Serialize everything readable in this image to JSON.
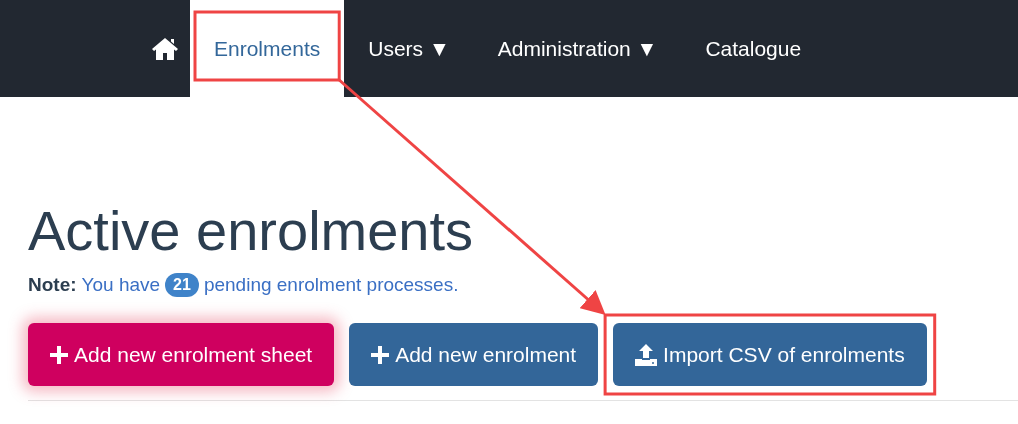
{
  "nav": {
    "items": [
      {
        "kind": "home",
        "selected": false,
        "highlighted": false
      },
      {
        "kind": "link",
        "label": "Enrolments",
        "selected": true,
        "highlighted": true
      },
      {
        "kind": "dropdown",
        "label": "Users",
        "caret": "▼",
        "selected": false,
        "highlighted": false
      },
      {
        "kind": "dropdown",
        "label": "Administration",
        "caret": "▼",
        "selected": false,
        "highlighted": false
      },
      {
        "kind": "link",
        "label": "Catalogue",
        "selected": false,
        "highlighted": false
      }
    ]
  },
  "page": {
    "title": "Active enrolments",
    "note": {
      "label": "Note:",
      "before": "You have",
      "count": "21",
      "after": "pending enrolment processes."
    },
    "buttons": [
      {
        "kind": "sheet",
        "label": "Add new enrolment sheet",
        "focused": true,
        "highlighted": false
      },
      {
        "kind": "add",
        "label": "Add new enrolment",
        "focused": false,
        "highlighted": false
      },
      {
        "kind": "import",
        "label": "Import CSV of enrolments",
        "focused": false,
        "highlighted": true
      }
    ]
  },
  "annotation": {
    "arrow": true
  }
}
